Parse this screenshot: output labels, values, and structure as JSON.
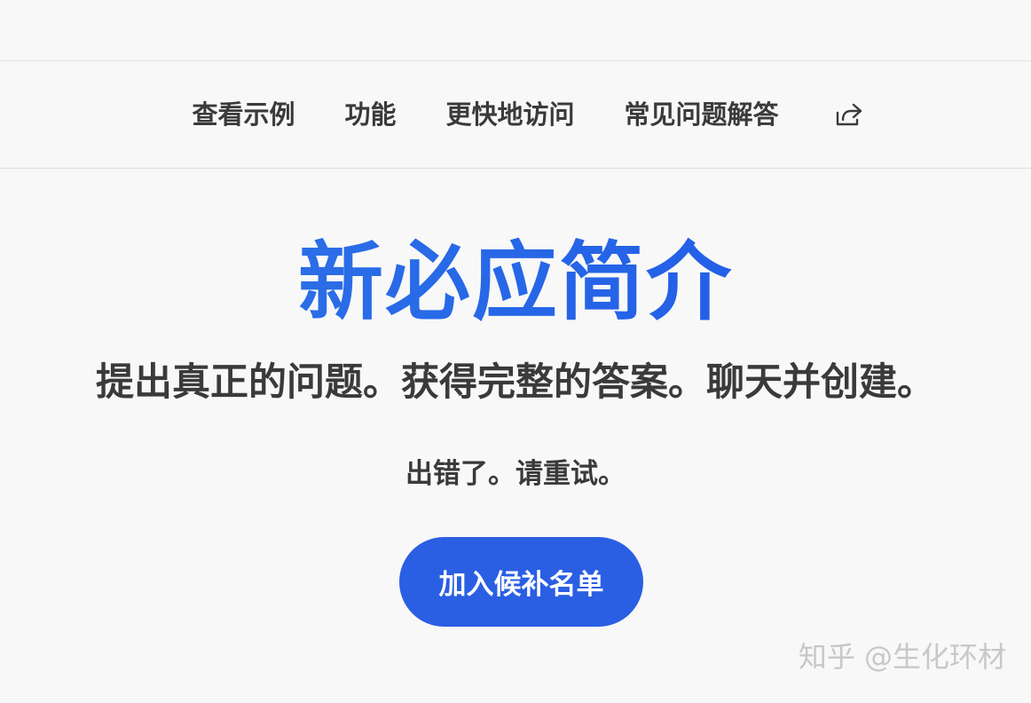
{
  "nav": {
    "items": [
      {
        "label": "查看示例"
      },
      {
        "label": "功能"
      },
      {
        "label": "更快地访问"
      },
      {
        "label": "常见问题解答"
      }
    ],
    "share_icon": "share-icon"
  },
  "hero": {
    "title": "新必应简介",
    "subtitle": "提出真正的问题。获得完整的答案。聊天并创建。",
    "error": "出错了。请重试。",
    "cta_label": "加入候补名单"
  },
  "watermark": "知乎 @生化环材",
  "colors": {
    "accent": "#2a5fe3",
    "title_gradient_start": "#2f78e6",
    "title_gradient_end": "#1f55e8",
    "text": "#3a3a3a",
    "background": "#f8f8f8"
  }
}
